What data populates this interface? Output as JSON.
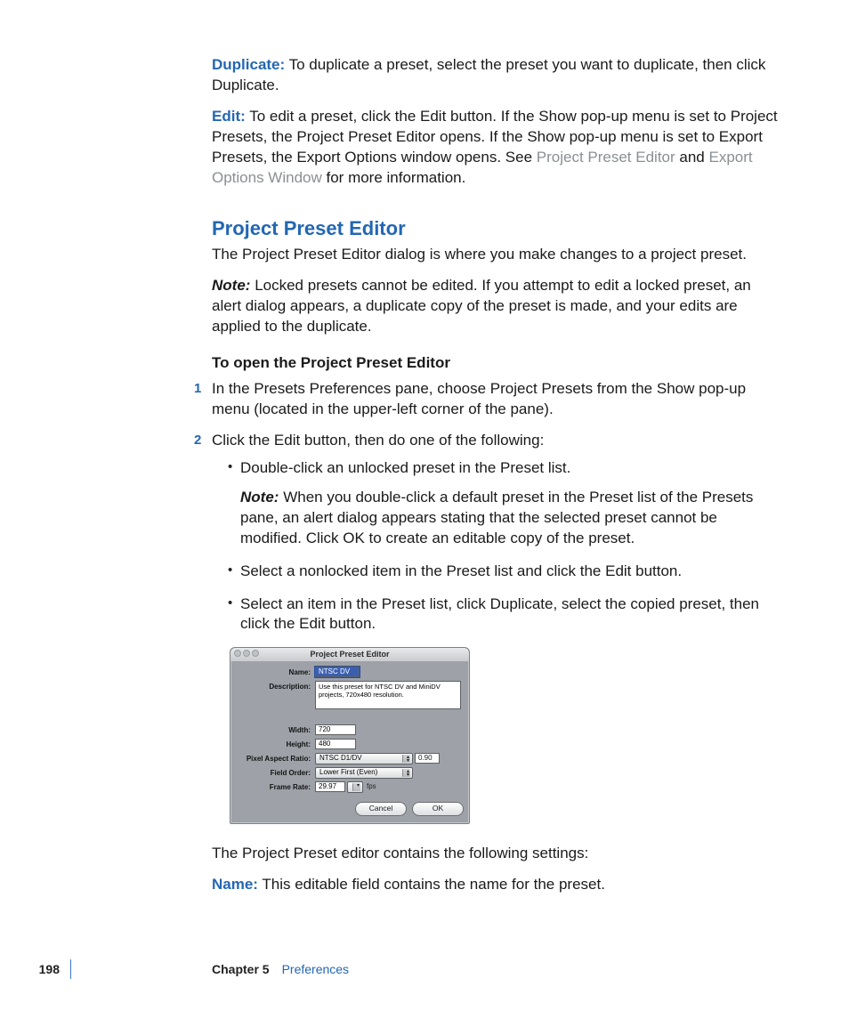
{
  "paragraphs": {
    "duplicate_label": "Duplicate:",
    "duplicate_text": "To duplicate a preset, select the preset you want to duplicate, then click Duplicate.",
    "edit_label": "Edit:",
    "edit_text_1": "To edit a preset, click the Edit button. If the Show pop-up menu is set to Project Presets, the Project Preset Editor opens. If the Show pop-up menu is set to Export Presets, the Export Options window opens. See ",
    "link_ppe": "Project Preset Editor",
    "and_word": " and ",
    "link_eow": "Export Options Window",
    "edit_text_2": " for more information."
  },
  "section_heading": "Project Preset Editor",
  "section_intro": "The Project Preset Editor dialog is where you make changes to a project preset.",
  "note1_label": "Note:",
  "note1_text": "Locked presets cannot be edited. If you attempt to edit a locked preset, an alert dialog appears, a duplicate copy of the preset is made, and your edits are applied to the duplicate.",
  "subhead": "To open the Project Preset Editor",
  "step1": "In the Presets Preferences pane, choose Project Presets from the Show pop-up menu (located in the upper-left corner of the pane).",
  "step2": "Click the Edit button, then do one of the following:",
  "bullets": {
    "b1": "Double-click an unlocked preset in the Preset list.",
    "b1_note_label": "Note:",
    "b1_note_text": "When you double-click a default preset in the Preset list of the Presets pane, an alert dialog appears stating that the selected preset cannot be modified. Click OK to create an editable copy of the preset.",
    "b2": "Select a nonlocked item in the Preset list and click the Edit button.",
    "b3": "Select an item in the Preset list, click Duplicate, select the copied preset, then click the Edit button."
  },
  "dialog": {
    "title": "Project Preset Editor",
    "labels": {
      "name": "Name:",
      "description": "Description:",
      "width": "Width:",
      "height": "Height:",
      "par": "Pixel Aspect Ratio:",
      "field_order": "Field Order:",
      "frame_rate": "Frame Rate:"
    },
    "values": {
      "name": "NTSC DV",
      "description": "Use this preset for NTSC DV and MiniDV projects, 720x480 resolution.",
      "width": "720",
      "height": "480",
      "par_select": "NTSC D1/DV",
      "par_value": "0.90",
      "field_order": "Lower First (Even)",
      "frame_rate": "29.97",
      "fps_unit": "fps"
    },
    "buttons": {
      "cancel": "Cancel",
      "ok": "OK"
    }
  },
  "after_dialog": "The Project Preset editor contains the following settings:",
  "name_para_label": "Name:",
  "name_para_text": "This editable field contains the name for the preset.",
  "footer": {
    "page": "198",
    "chapter": "Chapter 5",
    "title": "Preferences"
  }
}
